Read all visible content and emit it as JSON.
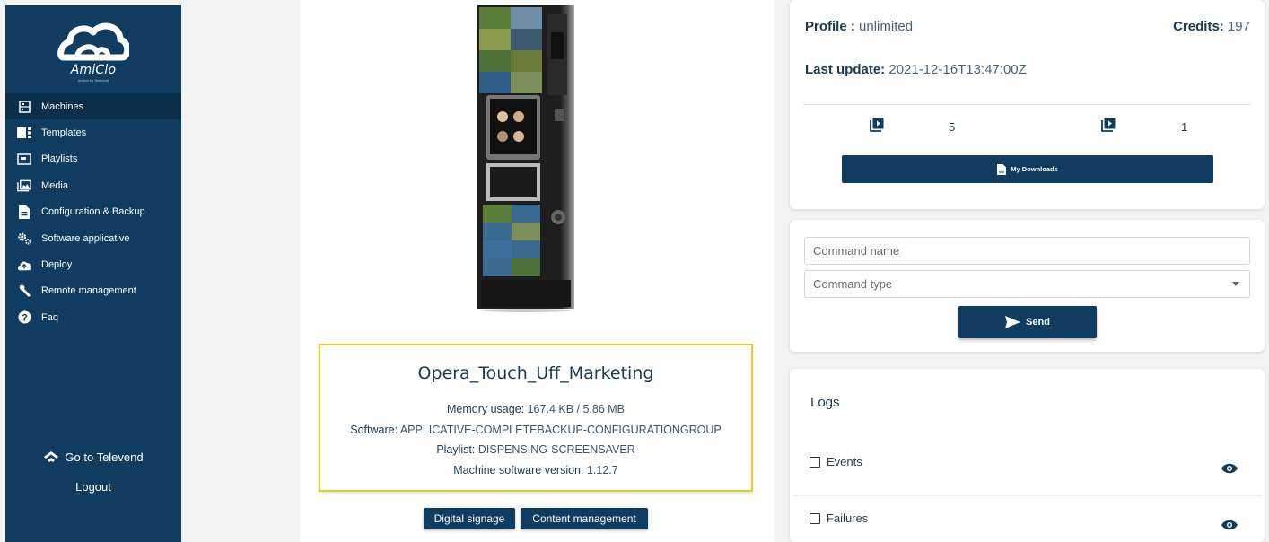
{
  "app": {
    "logo_text": "AmiClo",
    "logo_sub": "Amiclo by Televend"
  },
  "sidebar": {
    "items": [
      {
        "label": "Machines",
        "icon": "machine-icon"
      },
      {
        "label": "Templates",
        "icon": "template-icon"
      },
      {
        "label": "Playlists",
        "icon": "playlist-icon"
      },
      {
        "label": "Media",
        "icon": "media-icon"
      },
      {
        "label": "Configuration & Backup",
        "icon": "file-icon"
      },
      {
        "label": "Software applicative",
        "icon": "gears-icon"
      },
      {
        "label": "Deploy",
        "icon": "cloud-upload-icon"
      },
      {
        "label": "Remote management",
        "icon": "wrench-icon"
      },
      {
        "label": "Faq",
        "icon": "help-icon"
      }
    ],
    "go_to_televend": "Go to Televend",
    "logout": "Logout"
  },
  "machine": {
    "name": "Opera_Touch_Uff_Marketing",
    "memory_label": "Memory usage:",
    "memory_value": "167.4 KB / 5.86 MB",
    "software_label": "Software:",
    "software_value": "APPLICATIVE-COMPLETEBACKUP-CONFIGURATIONGROUP",
    "playlist_label": "Playlist:",
    "playlist_value": "DISPENSING-SCREENSAVER",
    "version_label": "Machine software version:",
    "version_value": "1.12.7",
    "digital_signage_btn": "Digital signage",
    "content_mgmt_btn": "Content management"
  },
  "profile": {
    "profile_label": "Profile :",
    "profile_value": "unlimited",
    "credits_label": "Credits:",
    "credits_value": "197",
    "last_update_label": "Last update:",
    "last_update_value": "2021-12-16T13:47:00Z",
    "count_left": "5",
    "count_right": "1",
    "downloads_btn": "My Downloads"
  },
  "command": {
    "name_placeholder": "Command name",
    "type_placeholder": "Command type",
    "send_btn": "Send"
  },
  "logs": {
    "title": "Logs",
    "rows": [
      {
        "label": "Events"
      },
      {
        "label": "Failures"
      }
    ]
  },
  "colors": {
    "primary": "#0f3c5f",
    "highlight_border": "#e4cf22"
  }
}
